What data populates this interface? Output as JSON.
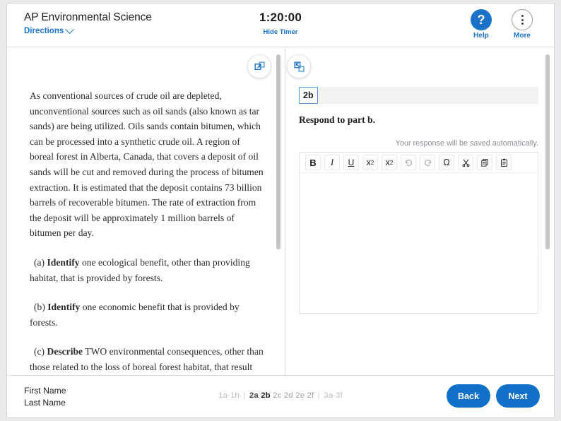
{
  "header": {
    "exam_title": "AP Environmental Science",
    "directions_label": "Directions",
    "directions_icon": "chevron-down-icon",
    "timer": "1:20:00",
    "hide_timer_label": "Hide Timer",
    "help_icon": "question-mark-icon",
    "help_label": "Help",
    "more_icon": "three-dots-vertical-icon",
    "more_label": "More"
  },
  "left_pane": {
    "toggle_icon": "expand-panel-icon",
    "passage": "As conventional sources of crude oil are depleted, unconventional sources such as oil sands (also known as tar sands) are being utilized. Oils sands contain bitumen, which can be processed into a synthetic crude oil. A region of boreal forest in Alberta, Canada, that covers a deposit of oil sands will be cut and removed during the process of bitumen extraction. It is estimated that the deposit contains 73 billion barrels of recoverable bitumen. The rate of extraction from the deposit will be approximately 1 million barrels of bitumen per day.",
    "parts": [
      {
        "letter": "(a)",
        "verb": "Identify",
        "text": " one ecological benefit, other than providing habitat, that is provided by forests."
      },
      {
        "letter": "(b)",
        "verb": "Identify",
        "text": " one economic benefit that is provided by forests."
      },
      {
        "letter": "(c)",
        "verb": "Describe",
        "text": " TWO environmental consequences, other than those related to the loss of boreal forest habitat, that result from the extraction of bitumen or the transportation of synthetic oil to customers."
      }
    ]
  },
  "right_pane": {
    "toggle_icon": "collapse-panel-icon",
    "question_badge": "2b",
    "prompt": "Respond to part b.",
    "autosave_notice": "Your response will be saved automatically.",
    "toolbar": [
      {
        "name": "bold-button",
        "label": "B",
        "style": "bold",
        "disabled": false
      },
      {
        "name": "italic-button",
        "label": "I",
        "style": "italic",
        "disabled": false
      },
      {
        "name": "underline-button",
        "label": "U",
        "style": "under",
        "disabled": false
      },
      {
        "name": "superscript-button",
        "label": "x²",
        "style": "sup",
        "disabled": false
      },
      {
        "name": "subscript-button",
        "label": "x₂",
        "style": "sub",
        "disabled": false
      },
      {
        "name": "undo-button",
        "label": "↺",
        "style": "dim",
        "disabled": true
      },
      {
        "name": "redo-button",
        "label": "↻",
        "style": "dim",
        "disabled": true
      },
      {
        "name": "special-character-button",
        "label": "Ω",
        "style": "plain",
        "disabled": false
      },
      {
        "name": "cut-button",
        "label": "✂",
        "style": "plain",
        "disabled": false
      },
      {
        "name": "copy-button",
        "label": "copy-icon",
        "style": "plain",
        "disabled": false
      },
      {
        "name": "paste-button",
        "label": "paste-icon",
        "style": "plain",
        "disabled": false
      }
    ],
    "response_text": ""
  },
  "footer": {
    "first_name": "First Name",
    "last_name": "Last Name",
    "question_nav": {
      "group1": "1a-1h",
      "items": [
        "2a",
        "2b",
        "2c",
        "2d",
        "2e",
        "2f"
      ],
      "current": "2b",
      "answered": [
        "2a"
      ],
      "group3": "3a-3f",
      "separator": "|"
    },
    "back_label": "Back",
    "next_label": "Next"
  },
  "colors": {
    "accent_blue": "#1171c8",
    "link_blue": "#1a73c8",
    "badge_border": "#5b9bd5"
  }
}
